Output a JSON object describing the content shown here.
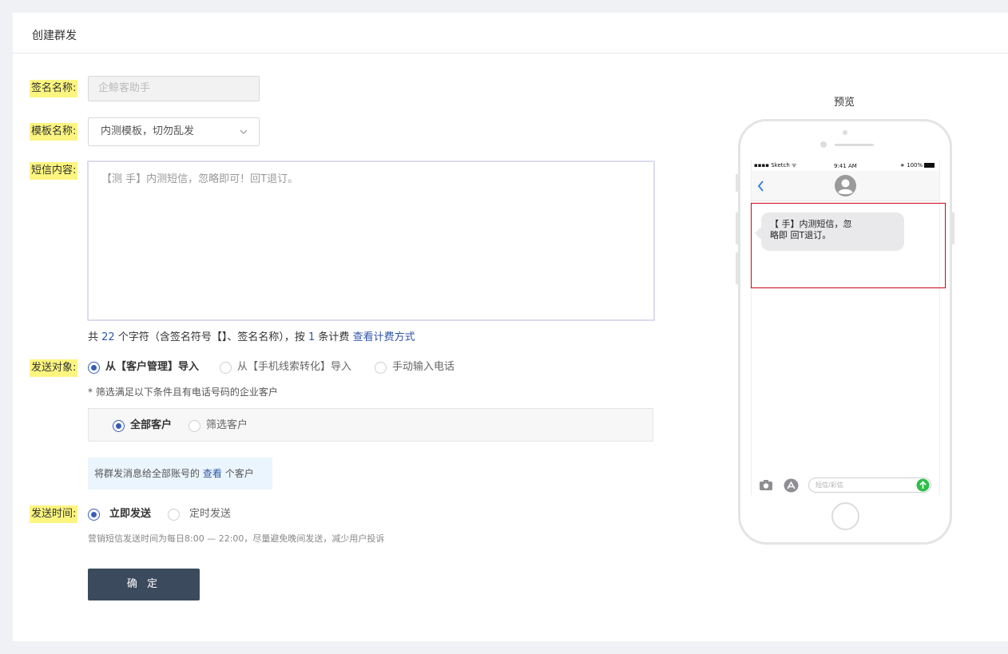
{
  "header": {
    "title": "创建群发"
  },
  "form": {
    "signature": {
      "label": "签名名称:",
      "placeholder": "企鲸客助手"
    },
    "template": {
      "label": "模板名称:",
      "value": "内测模板，切勿乱发"
    },
    "content": {
      "label": "短信内容:",
      "value": "【测 手】内测短信，忽略即可！回T退订。"
    },
    "char_count": {
      "prefix": "共",
      "count": "22",
      "middle": "个字符（含签名符号【】、签名名称），按",
      "billing_count": "1",
      "suffix": "条计费",
      "link": "查看计费方式"
    },
    "target": {
      "label": "发送对象:",
      "options": [
        "从【客户管理】导入",
        "从【手机线索转化】导入",
        "手动输入电话"
      ],
      "selected": 0,
      "note": "* 筛选满足以下条件且有电话号码的企业客户",
      "sub_options": [
        "全部客户",
        "筛选客户"
      ],
      "sub_selected": 0,
      "info_prefix": "将群发消息给全部账号的",
      "info_link": "查看",
      "info_suffix": "个客户"
    },
    "send_time": {
      "label": "发送时间:",
      "options": [
        "立即发送",
        "定时发送"
      ],
      "selected": 0,
      "note": "营销短信发送时间为每日8:00 — 22:00，尽量避免晚间发送，减少用户投诉"
    },
    "submit_label": "确 定"
  },
  "preview": {
    "title": "预览",
    "status_carrier": "Sketch",
    "status_time": "9:41 AM",
    "status_battery": "100%",
    "bubble_line1": "【 手】内测短信，忽",
    "bubble_line2": "略即 回T退订。",
    "input_placeholder": "短信/彩信",
    "colors": {
      "highlight_border": "#d0021b",
      "send_button": "#2fbf4a"
    }
  }
}
